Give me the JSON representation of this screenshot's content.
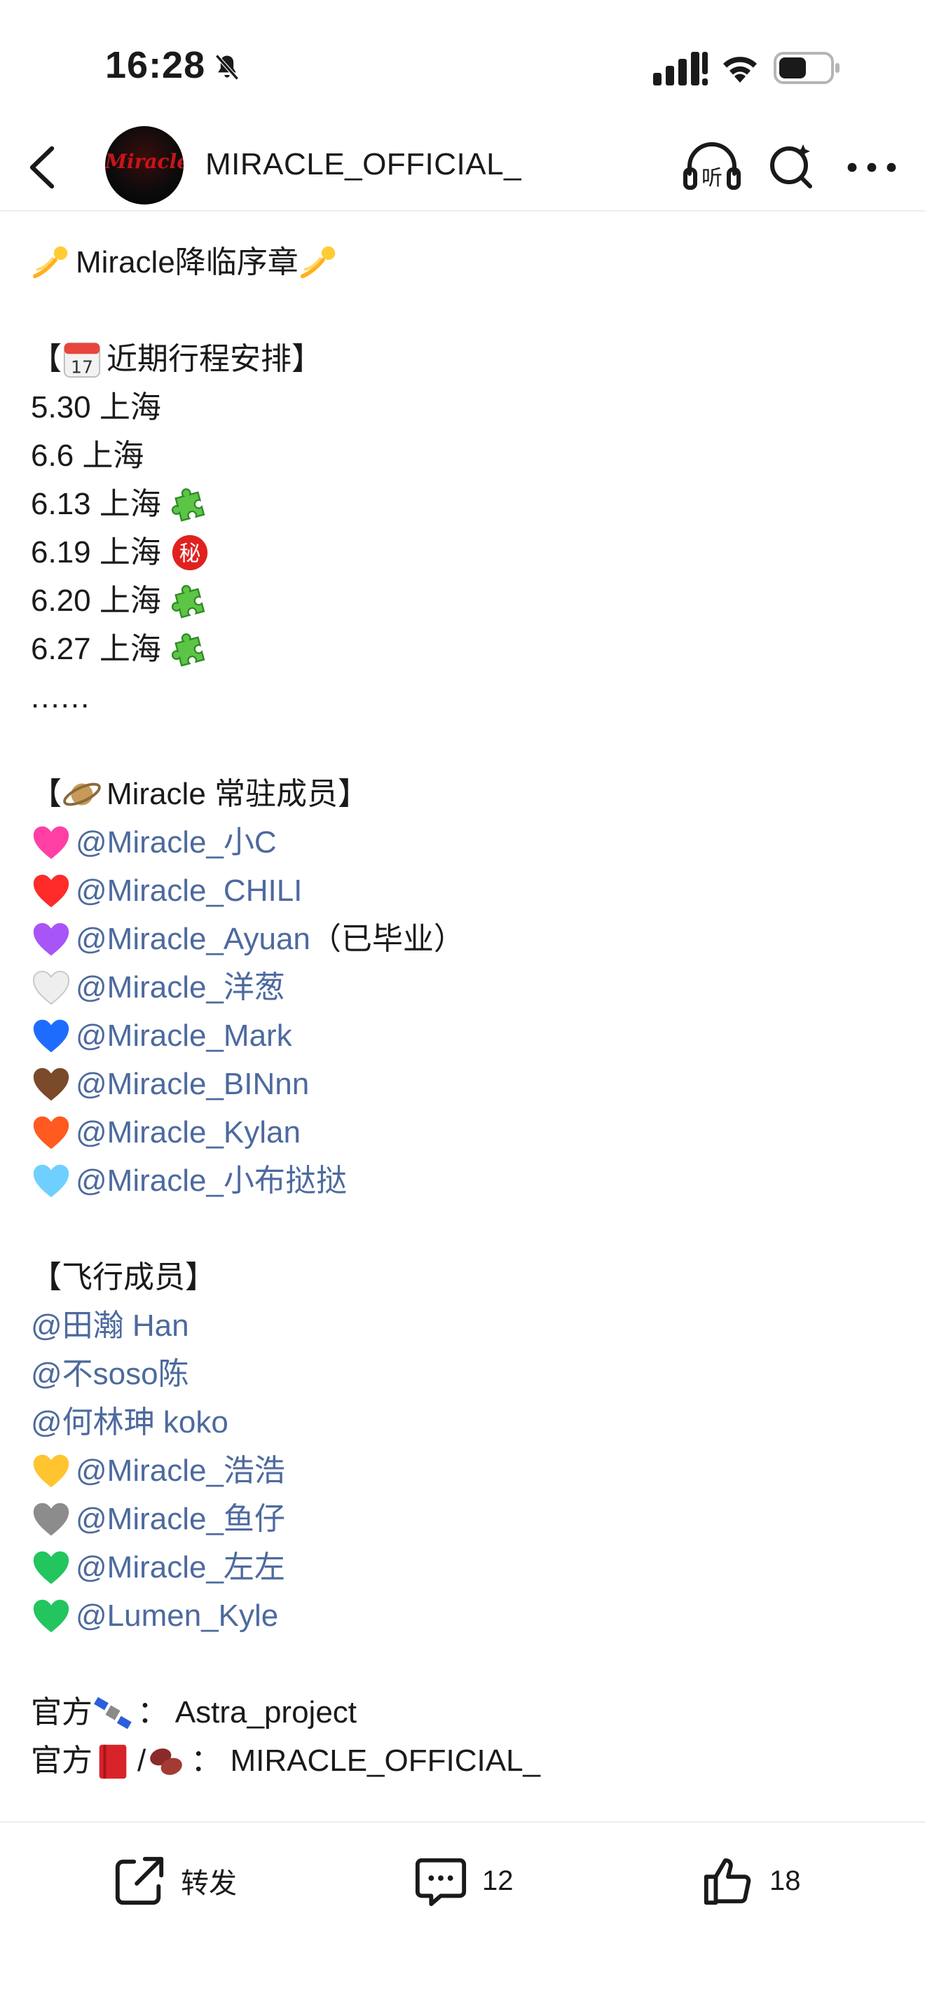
{
  "status_bar": {
    "time": "16:28"
  },
  "header": {
    "account_name": "MIRACLE_OFFICIAL_",
    "avatar_text": "Miracle"
  },
  "post": {
    "title": "Miracle降临序章",
    "schedule_heading": "近期行程安排】",
    "schedule_open": "【",
    "schedule": [
      {
        "date": "5.30 上海",
        "badge": ""
      },
      {
        "date": "6.6 上海",
        "badge": ""
      },
      {
        "date": "6.13 上海",
        "badge": "puzzle"
      },
      {
        "date": "6.19 上海",
        "badge": "secret"
      },
      {
        "date": "6.20 上海",
        "badge": "puzzle"
      },
      {
        "date": "6.27 上海",
        "badge": "puzzle"
      }
    ],
    "schedule_more": "......",
    "members_heading": "Miracle 常驻成员】",
    "members": [
      {
        "heart": "#ff3fa4",
        "name": "@Miracle_小C",
        "note": ""
      },
      {
        "heart": "#ff2a2a",
        "name": "@Miracle_CHILI",
        "note": ""
      },
      {
        "heart": "#a855f7",
        "name": "@Miracle_Ayuan",
        "note": "（已毕业）"
      },
      {
        "heart": "#eeeeee",
        "name": "@Miracle_洋葱",
        "note": ""
      },
      {
        "heart": "#1e6cff",
        "name": "@Miracle_Mark",
        "note": ""
      },
      {
        "heart": "#7a4a2a",
        "name": "@Miracle_BINnn",
        "note": ""
      },
      {
        "heart": "#ff5a1f",
        "name": "@Miracle_Kylan",
        "note": ""
      },
      {
        "heart": "#6fd0ff",
        "name": "@Miracle_小布挞挞",
        "note": ""
      }
    ],
    "flying_heading": "【飞行成员】",
    "flying_plain": [
      "@田瀚 Han",
      "@不soso陈",
      "@何林珅 koko"
    ],
    "flying_hearts": [
      {
        "heart": "#ffc42e",
        "name": "@Miracle_浩浩"
      },
      {
        "heart": "#8c8c8c",
        "name": "@Miracle_鱼仔"
      },
      {
        "heart": "#22c55e",
        "name": "@Miracle_左左"
      },
      {
        "heart": "#22c55e",
        "name": "@Lumen_Kyle"
      }
    ],
    "official_prefix": "官方",
    "official_1_value": "： Astra_project",
    "official_slash": "/",
    "official_2_value": "： MIRACLE_OFFICIAL_"
  },
  "actions": {
    "repost_label": "转发",
    "comment_count": "12",
    "like_count": "18"
  }
}
